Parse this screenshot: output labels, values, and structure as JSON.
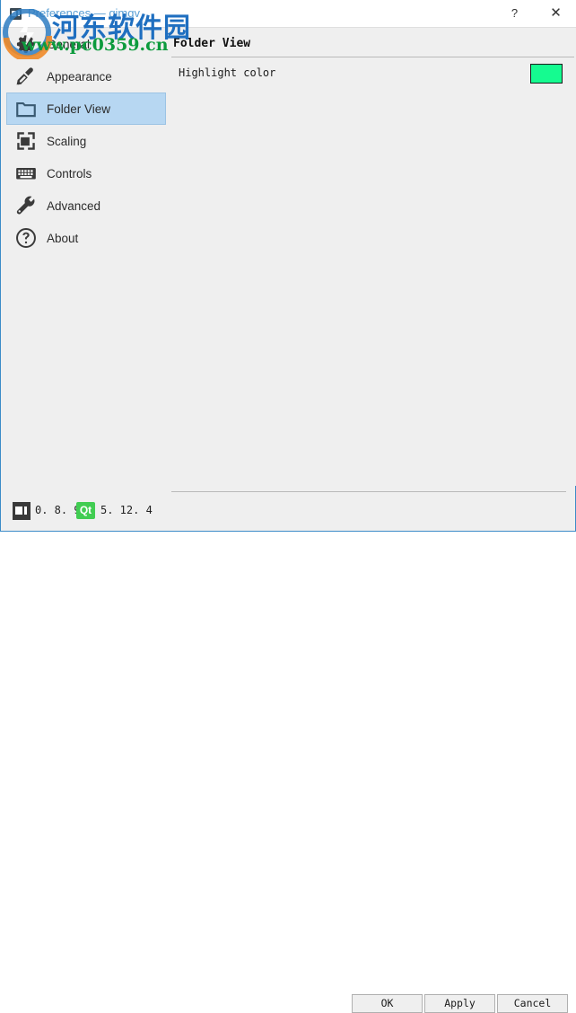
{
  "window": {
    "title": "Preferences — qimgv",
    "icon": "app-icon",
    "border_color": "#3c8cc8",
    "background": "#efefef"
  },
  "titlebar": {
    "help_label": "?",
    "close_label": "✕"
  },
  "sidebar": {
    "selected_index": 2,
    "selection_color": "#b7d7f2",
    "items": [
      {
        "label": "General",
        "icon": "gear-icon"
      },
      {
        "label": "Appearance",
        "icon": "paintbrush-icon"
      },
      {
        "label": "Folder View",
        "icon": "folder-icon"
      },
      {
        "label": "Scaling",
        "icon": "scaling-icon"
      },
      {
        "label": "Controls",
        "icon": "keyboard-icon"
      },
      {
        "label": "Advanced",
        "icon": "wrench-icon"
      },
      {
        "label": "About",
        "icon": "question-circle-icon"
      }
    ]
  },
  "content": {
    "panel_title": "Folder View",
    "highlight_color": {
      "label": "Highlight color",
      "value": "#15fb90"
    }
  },
  "statusbar": {
    "app_version": "0. 8. 9",
    "qt_badge": "Qt",
    "qt_version": "5. 12. 4"
  },
  "buttons": {
    "ok": "OK",
    "apply": "Apply",
    "cancel": "Cancel"
  },
  "watermark": {
    "site_name": "河东软件园",
    "site_url": "www.pc0359.cn"
  }
}
